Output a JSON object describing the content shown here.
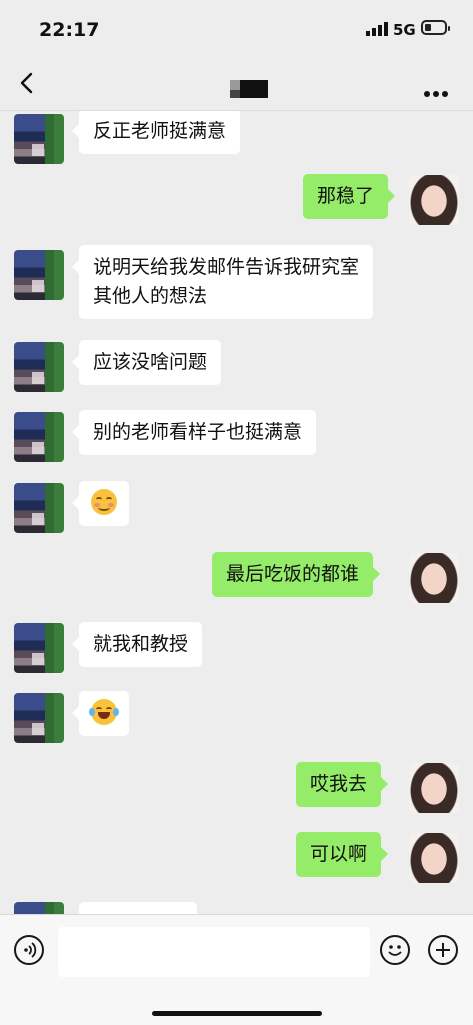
{
  "status_bar": {
    "time": "22:17",
    "network": "5G"
  },
  "nav": {
    "back_icon": "chevron-left-icon",
    "more_icon": "more-dots-icon"
  },
  "messages": [
    {
      "side": "left",
      "text": "反正老师挺满意"
    },
    {
      "side": "right",
      "text": "那稳了"
    },
    {
      "side": "left",
      "text": "说明天给我发邮件告诉我研究室",
      "text2": "其他人的想法"
    },
    {
      "side": "left",
      "text": "应该没啥问题"
    },
    {
      "side": "left",
      "text": "别的老师看样子也挺满意"
    },
    {
      "side": "left",
      "emoji": "blushing-smile-emoji"
    },
    {
      "side": "right",
      "text": "最后吃饭的都谁"
    },
    {
      "side": "left",
      "text": "就我和教授"
    },
    {
      "side": "left",
      "emoji": "laughing-tears-emoji"
    },
    {
      "side": "right",
      "text": "哎我去"
    },
    {
      "side": "right",
      "text": "可以啊"
    }
  ],
  "input_bar": {
    "voice_icon": "voice-icon",
    "emoji_icon": "emoji-icon",
    "plus_icon": "plus-icon"
  }
}
